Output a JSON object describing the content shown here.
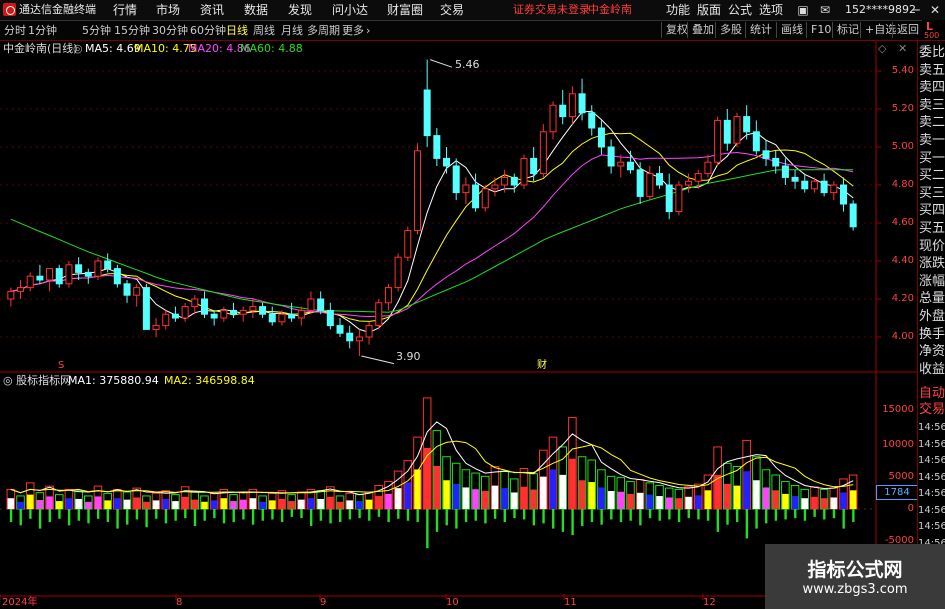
{
  "titlebar": {
    "app_title": "通达信金融终端",
    "menus": [
      "行情",
      "市场",
      "资讯",
      "数据",
      "发现",
      "问小达",
      "财富圈",
      "交易"
    ],
    "warning": "证券交易未登录",
    "stock_tag": "中金岭南",
    "right_menus": [
      "功能",
      "版面",
      "公式",
      "选项"
    ],
    "user": "152****9892"
  },
  "toolbar": {
    "periods": [
      "分时",
      "1分钟",
      "5分钟",
      "15分钟",
      "30分钟",
      "60分钟",
      "日线",
      "周线",
      "月线",
      "多周期",
      "更多"
    ],
    "active": "日线",
    "right": [
      "复权",
      "叠加",
      "多股",
      "统计",
      "画线",
      "F10",
      "+自选",
      "返回"
    ],
    "corner_l": "L",
    "corner_num": "500"
  },
  "sidebar": {
    "items": [
      "委比",
      "卖五",
      "卖四",
      "卖三",
      "卖二",
      "卖一",
      "买一",
      "买二",
      "买三",
      "买四",
      "买五",
      "现价",
      "涨跌",
      "涨幅",
      "总量",
      "外盘",
      "换手",
      "净资",
      "收益"
    ],
    "auto_trade_1": "自动",
    "auto_trade_2": "交易",
    "times": [
      "14:56",
      "14:56",
      "14:56",
      "14:56",
      "14:56",
      "14:56",
      "14:56",
      "14:56"
    ]
  },
  "main_chart": {
    "name": "中金岭南(日线)",
    "ma": [
      {
        "label": "MA5: 4.69",
        "color": "#ffffff"
      },
      {
        "label": "MA10: 4.75",
        "color": "#ffff00"
      },
      {
        "label": "MA20: 4.86",
        "color": "#ff44ff"
      },
      {
        "label": "MA60: 4.88",
        "color": "#22dd22"
      }
    ],
    "y_ticks": [
      "5.40",
      "5.20",
      "5.00",
      "4.80",
      "4.60",
      "4.40",
      "4.20",
      "4.00"
    ],
    "high_label": "5.46",
    "low_label": "3.90",
    "marker_s": "S",
    "marker_cai": "财"
  },
  "sub_chart": {
    "name": "股标指标网",
    "ma1": "MA1: 375880.94",
    "ma2": "MA2: 346598.84",
    "y_ticks": [
      "15000",
      "10000",
      "5000",
      "0",
      "-5000"
    ],
    "current": "1784"
  },
  "x_axis": [
    "2024年",
    "8",
    "9",
    "10",
    "11",
    "12"
  ],
  "watermark": {
    "line1": "指标公式网",
    "line2": "www.zbgs3.com"
  },
  "chart_data": {
    "type": "candlestick",
    "symbol": "中金岭南",
    "period": "日线",
    "ylim": [
      3.9,
      5.5
    ],
    "candles": [
      [
        4.2,
        4.26,
        4.16,
        4.24
      ],
      [
        4.24,
        4.3,
        4.2,
        4.26
      ],
      [
        4.26,
        4.34,
        4.24,
        4.32
      ],
      [
        4.32,
        4.38,
        4.28,
        4.3
      ],
      [
        4.3,
        4.36,
        4.24,
        4.36
      ],
      [
        4.36,
        4.38,
        4.26,
        4.28
      ],
      [
        4.28,
        4.4,
        4.26,
        4.38
      ],
      [
        4.38,
        4.42,
        4.3,
        4.34
      ],
      [
        4.34,
        4.36,
        4.28,
        4.32
      ],
      [
        4.32,
        4.42,
        4.3,
        4.4
      ],
      [
        4.4,
        4.44,
        4.34,
        4.36
      ],
      [
        4.36,
        4.38,
        4.26,
        4.28
      ],
      [
        4.28,
        4.3,
        4.18,
        4.22
      ],
      [
        4.22,
        4.28,
        4.16,
        4.26
      ],
      [
        4.26,
        4.28,
        4.1,
        4.04
      ],
      [
        4.04,
        4.1,
        4.0,
        4.06
      ],
      [
        4.06,
        4.14,
        4.04,
        4.12
      ],
      [
        4.12,
        4.16,
        4.08,
        4.1
      ],
      [
        4.1,
        4.18,
        4.08,
        4.16
      ],
      [
        4.16,
        4.22,
        4.12,
        4.2
      ],
      [
        4.2,
        4.24,
        4.1,
        4.12
      ],
      [
        4.12,
        4.14,
        4.06,
        4.1
      ],
      [
        4.1,
        4.16,
        4.08,
        4.14
      ],
      [
        4.14,
        4.18,
        4.1,
        4.12
      ],
      [
        4.12,
        4.16,
        4.08,
        4.14
      ],
      [
        4.14,
        4.2,
        4.1,
        4.16
      ],
      [
        4.16,
        4.18,
        4.1,
        4.12
      ],
      [
        4.12,
        4.16,
        4.06,
        4.08
      ],
      [
        4.08,
        4.14,
        4.06,
        4.12
      ],
      [
        4.12,
        4.18,
        4.08,
        4.1
      ],
      [
        4.1,
        4.16,
        4.06,
        4.14
      ],
      [
        4.14,
        4.24,
        4.12,
        4.2
      ],
      [
        4.2,
        4.24,
        4.12,
        4.14
      ],
      [
        4.14,
        4.18,
        4.04,
        4.06
      ],
      [
        4.06,
        4.1,
        4.0,
        4.02
      ],
      [
        4.02,
        4.06,
        3.94,
        3.98
      ],
      [
        3.98,
        4.04,
        3.9,
        4.0
      ],
      [
        4.0,
        4.08,
        3.96,
        4.06
      ],
      [
        4.06,
        4.2,
        4.04,
        4.18
      ],
      [
        4.18,
        4.28,
        4.14,
        4.26
      ],
      [
        4.26,
        4.44,
        4.24,
        4.42
      ],
      [
        4.42,
        4.58,
        4.4,
        4.56
      ],
      [
        4.56,
        5.02,
        4.54,
        4.98
      ],
      [
        5.3,
        5.46,
        5.0,
        5.06
      ],
      [
        5.06,
        5.1,
        4.9,
        4.94
      ],
      [
        4.94,
        5.0,
        4.86,
        4.9
      ],
      [
        4.9,
        4.94,
        4.72,
        4.76
      ],
      [
        4.76,
        4.84,
        4.7,
        4.8
      ],
      [
        4.8,
        4.86,
        4.66,
        4.68
      ],
      [
        4.68,
        4.8,
        4.66,
        4.78
      ],
      [
        4.78,
        4.84,
        4.74,
        4.8
      ],
      [
        4.8,
        4.88,
        4.76,
        4.84
      ],
      [
        4.84,
        4.86,
        4.76,
        4.8
      ],
      [
        4.8,
        4.96,
        4.78,
        4.94
      ],
      [
        4.94,
        5.0,
        4.82,
        4.86
      ],
      [
        4.86,
        5.12,
        4.84,
        5.08
      ],
      [
        5.08,
        5.24,
        5.04,
        5.22
      ],
      [
        5.22,
        5.3,
        5.12,
        5.16
      ],
      [
        5.16,
        5.32,
        5.12,
        5.28
      ],
      [
        5.28,
        5.36,
        5.14,
        5.18
      ],
      [
        5.18,
        5.22,
        5.06,
        5.1
      ],
      [
        5.1,
        5.14,
        4.96,
        5.0
      ],
      [
        5.0,
        5.04,
        4.86,
        4.9
      ],
      [
        4.9,
        4.96,
        4.84,
        4.92
      ],
      [
        4.92,
        4.98,
        4.86,
        4.88
      ],
      [
        4.88,
        4.92,
        4.7,
        4.74
      ],
      [
        4.74,
        4.9,
        4.72,
        4.86
      ],
      [
        4.86,
        4.9,
        4.78,
        4.8
      ],
      [
        4.8,
        4.86,
        4.62,
        4.66
      ],
      [
        4.66,
        4.82,
        4.64,
        4.8
      ],
      [
        4.8,
        4.86,
        4.76,
        4.82
      ],
      [
        4.82,
        4.88,
        4.78,
        4.86
      ],
      [
        4.86,
        4.96,
        4.84,
        4.92
      ],
      [
        4.92,
        5.16,
        4.9,
        5.14
      ],
      [
        5.14,
        5.2,
        4.98,
        5.02
      ],
      [
        5.02,
        5.18,
        5.0,
        5.16
      ],
      [
        5.16,
        5.22,
        5.04,
        5.08
      ],
      [
        5.08,
        5.14,
        4.96,
        4.98
      ],
      [
        4.98,
        5.04,
        4.9,
        4.94
      ],
      [
        4.94,
        4.98,
        4.86,
        4.9
      ],
      [
        4.9,
        4.94,
        4.8,
        4.84
      ],
      [
        4.84,
        4.88,
        4.78,
        4.82
      ],
      [
        4.82,
        4.86,
        4.76,
        4.78
      ],
      [
        4.78,
        4.84,
        4.76,
        4.82
      ],
      [
        4.82,
        4.86,
        4.74,
        4.76
      ],
      [
        4.76,
        4.82,
        4.72,
        4.8
      ],
      [
        4.8,
        4.84,
        4.66,
        4.7
      ],
      [
        4.7,
        4.72,
        4.56,
        4.58
      ]
    ],
    "ma_series": [
      {
        "name": "MA5",
        "color": "#ffffff"
      },
      {
        "name": "MA10",
        "color": "#ffff00"
      },
      {
        "name": "MA20",
        "color": "#ff44ff"
      },
      {
        "name": "MA60",
        "color": "#22dd22"
      }
    ],
    "sub_indicator": {
      "name": "股标指标网",
      "ylim": [
        -6000,
        18000
      ],
      "bars": [
        [
          3000,
          -2000
        ],
        [
          2000,
          -2500
        ],
        [
          4000,
          -1500
        ],
        [
          2500,
          -3000
        ],
        [
          3500,
          -2000
        ],
        [
          2200,
          -1500
        ],
        [
          3000,
          -2500
        ],
        [
          2800,
          -1800
        ],
        [
          2000,
          -2200
        ],
        [
          3500,
          -1500
        ],
        [
          2400,
          -2000
        ],
        [
          3000,
          -3000
        ],
        [
          2600,
          -2400
        ],
        [
          3200,
          -1600
        ],
        [
          2000,
          -2800
        ],
        [
          2400,
          -1500
        ],
        [
          2800,
          -2200
        ],
        [
          2200,
          -1800
        ],
        [
          3400,
          -1400
        ],
        [
          2600,
          -2600
        ],
        [
          2000,
          -1800
        ],
        [
          2400,
          -1400
        ],
        [
          3000,
          -2200
        ],
        [
          2200,
          -2000
        ],
        [
          2600,
          -1600
        ],
        [
          3000,
          -2400
        ],
        [
          2000,
          -1800
        ],
        [
          2400,
          -1600
        ],
        [
          2800,
          -2000
        ],
        [
          2200,
          -1200
        ],
        [
          2600,
          -1400
        ],
        [
          3000,
          -2600
        ],
        [
          2800,
          -1800
        ],
        [
          3400,
          -2200
        ],
        [
          2000,
          -2000
        ],
        [
          2400,
          -1600
        ],
        [
          2200,
          -1400
        ],
        [
          2600,
          -1800
        ],
        [
          3600,
          -1200
        ],
        [
          4200,
          -2000
        ],
        [
          5800,
          -1500
        ],
        [
          7400,
          -1800
        ],
        [
          11000,
          -2000
        ],
        [
          17000,
          -6000
        ],
        [
          12000,
          -3500
        ],
        [
          8000,
          -2500
        ],
        [
          7000,
          -3000
        ],
        [
          6000,
          -2000
        ],
        [
          5500,
          -1800
        ],
        [
          5000,
          -2200
        ],
        [
          6500,
          -1500
        ],
        [
          5800,
          -2000
        ],
        [
          4600,
          -1400
        ],
        [
          6200,
          -1600
        ],
        [
          5400,
          -2500
        ],
        [
          9000,
          -2200
        ],
        [
          11000,
          -3000
        ],
        [
          9500,
          -3500
        ],
        [
          14000,
          -4000
        ],
        [
          8000,
          -2600
        ],
        [
          7500,
          -2000
        ],
        [
          6000,
          -2400
        ],
        [
          5000,
          -1600
        ],
        [
          4800,
          -2000
        ],
        [
          4200,
          -1800
        ],
        [
          4500,
          -2500
        ],
        [
          4000,
          -1400
        ],
        [
          3600,
          -1800
        ],
        [
          3200,
          -1600
        ],
        [
          3000,
          -2000
        ],
        [
          3400,
          -1400
        ],
        [
          3800,
          -1600
        ],
        [
          5200,
          -1800
        ],
        [
          9500,
          -3500
        ],
        [
          7000,
          -2400
        ],
        [
          6500,
          -2000
        ],
        [
          10500,
          -4500
        ],
        [
          8000,
          -3000
        ],
        [
          6000,
          -2200
        ],
        [
          5200,
          -1800
        ],
        [
          4200,
          -1600
        ],
        [
          3600,
          -1400
        ],
        [
          3000,
          -1800
        ],
        [
          3400,
          -1200
        ],
        [
          3000,
          -1600
        ],
        [
          3200,
          -1400
        ],
        [
          4600,
          -3000
        ],
        [
          5200,
          -2000
        ]
      ],
      "ma1_color": "#ffffff",
      "ma2_color": "#ffff00"
    }
  }
}
